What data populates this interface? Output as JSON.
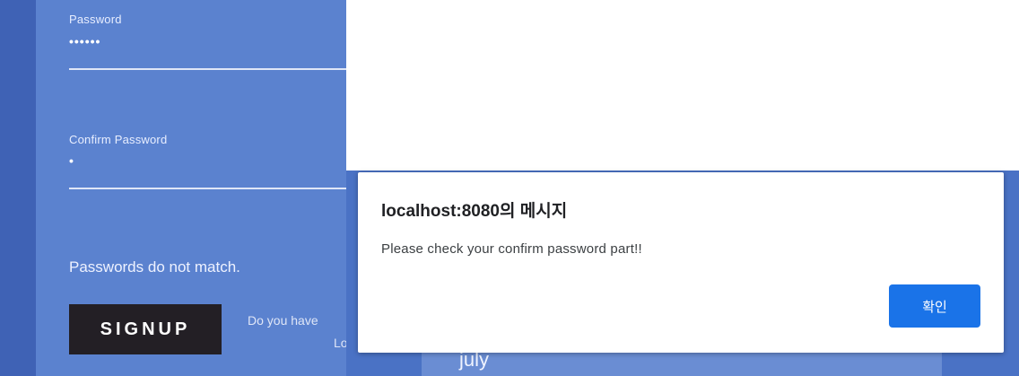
{
  "signup_form": {
    "password_label": "Password",
    "password_value": "••••••",
    "confirm_label": "Confirm Password",
    "confirm_value": "•",
    "error_message": "Passwords do not match.",
    "signup_button": "SIGNUP",
    "have_account_text": "Do you have",
    "login_link_text": "Lo"
  },
  "background": {
    "month_text": "july"
  },
  "alert": {
    "title": "localhost:8080의 메시지",
    "message": "Please check your confirm password part!!",
    "confirm_button": "확인"
  }
}
